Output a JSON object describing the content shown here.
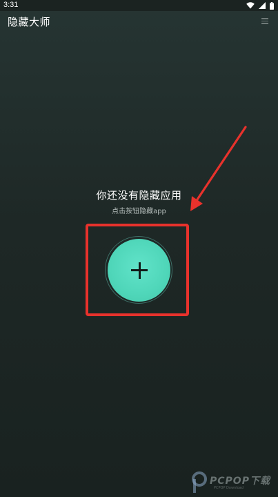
{
  "status_bar": {
    "time": "3:31"
  },
  "app_bar": {
    "title": "隐藏大师",
    "menu_icon": "hamburger-menu-icon"
  },
  "empty_state": {
    "title": "你还没有隐藏应用",
    "subtitle": "点击按钮隐藏app",
    "add_icon": "plus-icon"
  },
  "watermark": {
    "text": "PCPOP下载",
    "small_text": "PCPOP Download"
  },
  "colors": {
    "background_top": "#263533",
    "background_bottom": "#192220",
    "accent": "#4fd6b9",
    "highlight": "#e8322c"
  }
}
